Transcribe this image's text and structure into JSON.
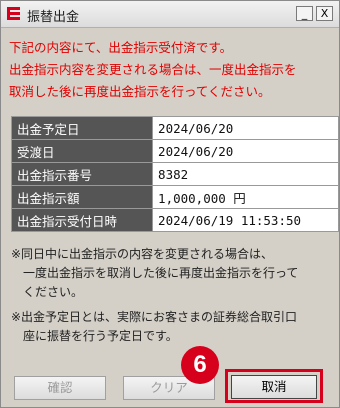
{
  "window": {
    "title": "振替出金",
    "minimize_glyph": "_",
    "close_glyph": "X",
    "icon": "app-logo-icon"
  },
  "notice": {
    "lines": [
      "下記の内容にて、出金指示受付済です。",
      "出金指示内容を変更される場合は、一度出金指示を",
      "取消した後に再度出金指示を行ってください。"
    ],
    "color": "#e00000"
  },
  "details": {
    "rows": [
      {
        "label": "出金予定日",
        "value": "2024/06/20"
      },
      {
        "label": "受渡日",
        "value": "2024/06/20"
      },
      {
        "label": "出金指示番号",
        "value": "8382"
      },
      {
        "label": "出金指示額",
        "value": "1,000,000 円"
      },
      {
        "label": "出金指示受付日時",
        "value": "2024/06/19 11:53:50"
      }
    ]
  },
  "notes": [
    {
      "lines": [
        "※同日中に出金指示の内容を変更される場合は、",
        "一度出金指示を取消した後に再度出金指示を行って",
        "ください。"
      ]
    },
    {
      "lines": [
        "※出金予定日とは、実際にお客さまの証券総合取引口",
        "座に振替を行う予定日です。"
      ]
    }
  ],
  "buttons": {
    "confirm": "確認",
    "clear": "クリア",
    "cancel": "取消"
  },
  "annotation": {
    "step": "6",
    "color": "#d6001c"
  }
}
